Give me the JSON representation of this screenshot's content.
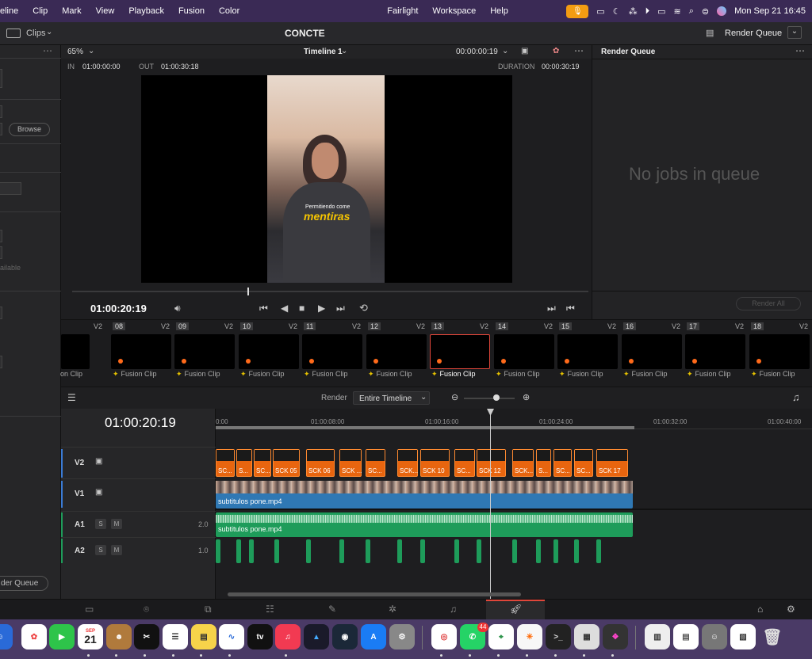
{
  "menubar": {
    "items": [
      "eline",
      "Clip",
      "Mark",
      "View",
      "Playback",
      "Fusion",
      "Color",
      "Fairlight",
      "Workspace",
      "Help"
    ],
    "clock": "Mon Sep 21  16:45"
  },
  "topbar": {
    "clips_label": "Clips",
    "project_title": "CONCTE",
    "render_queue_btn": "Render Queue"
  },
  "left_panel": {
    "browse_label": "Browse",
    "available_text": "ailable",
    "render_queue_btn": "der Queue"
  },
  "viewer": {
    "zoom": "65%",
    "timeline_name": "Timeline 1",
    "timecode_top": "00:00:00:19",
    "in_label": "IN",
    "in_value": "01:00:00:00",
    "out_label": "OUT",
    "out_value": "01:00:30:18",
    "duration_label": "DURATION",
    "duration_value": "00:00:30:19",
    "current_tc": "01:00:20:19",
    "overlay_text_1": "Permitiendo come",
    "overlay_text_2": "mentiras"
  },
  "render_queue": {
    "title": "Render Queue",
    "empty_text": "No jobs in queue",
    "render_all": "Render All"
  },
  "strip": {
    "track_label": "V2",
    "thumbs": [
      {
        "num": "08",
        "label": "Fusion Clip",
        "selected": false
      },
      {
        "num": "09",
        "label": "Fusion Clip",
        "selected": false
      },
      {
        "num": "10",
        "label": "Fusion Clip",
        "selected": false
      },
      {
        "num": "11",
        "label": "Fusion Clip",
        "selected": false
      },
      {
        "num": "12",
        "label": "Fusion Clip",
        "selected": false
      },
      {
        "num": "13",
        "label": "Fusion Clip",
        "selected": true
      },
      {
        "num": "14",
        "label": "Fusion Clip",
        "selected": false
      },
      {
        "num": "15",
        "label": "Fusion Clip",
        "selected": false
      },
      {
        "num": "16",
        "label": "Fusion Clip",
        "selected": false
      },
      {
        "num": "17",
        "label": "Fusion Clip",
        "selected": false
      },
      {
        "num": "18",
        "label": "Fusion Clip",
        "selected": false
      }
    ],
    "first_partial_label": "on Clip"
  },
  "timeline": {
    "render_label": "Render",
    "render_mode": "Entire Timeline",
    "current_tc": "01:00:20:19",
    "ruler": [
      "0:00",
      "01:00:08:00",
      "01:00:16:00",
      "01:00:24:00",
      "01:00:32:00",
      "01:00:40:00"
    ],
    "tracks": [
      {
        "name": "V2",
        "type": "video"
      },
      {
        "name": "V1",
        "type": "video",
        "clip": "subtitulos pone.mp4"
      },
      {
        "name": "A1",
        "type": "audio",
        "level": "2.0",
        "clip": "subtitulos pone.mp4"
      },
      {
        "name": "A2",
        "type": "audio",
        "level": "1.0"
      }
    ],
    "v2_clips": [
      "SC...",
      "S...",
      "SC...",
      "SCK 05",
      "SCK 06",
      "SCK ...",
      "SC...",
      "SCK...",
      "SCK 10",
      "SC...",
      "SCK 12",
      "SCK...",
      "S...",
      "SC...",
      "SC...",
      "SCK 17"
    ],
    "solo": "S",
    "mute": "M"
  },
  "dock": {
    "calendar_month": "SEP",
    "calendar_day": "21",
    "whatsapp_badge": "44",
    "tv_label": "tv"
  }
}
